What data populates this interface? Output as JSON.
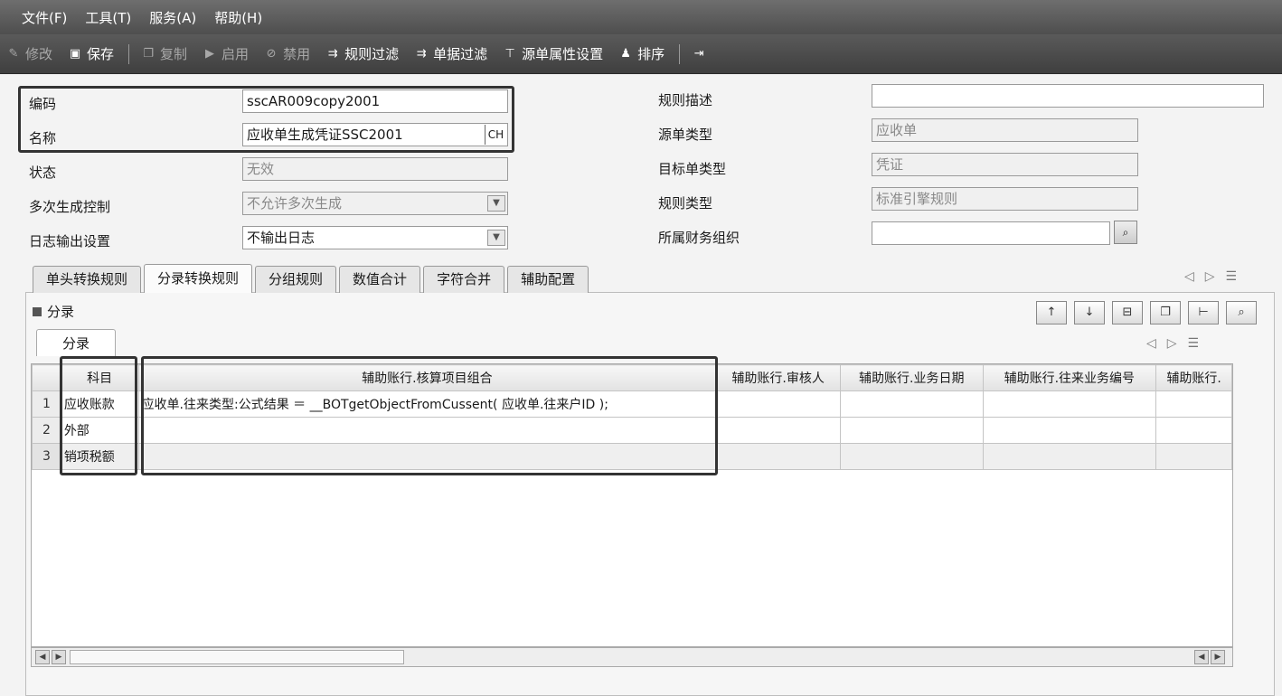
{
  "menu": [
    "文件(F)",
    "工具(T)",
    "服务(A)",
    "帮助(H)"
  ],
  "toolbar": [
    {
      "label": "修改",
      "icon": "edit-icon",
      "disabled": true
    },
    {
      "label": "保存",
      "icon": "save-icon",
      "disabled": false
    },
    {
      "label": "复制",
      "icon": "copy-icon",
      "disabled": true
    },
    {
      "label": "启用",
      "icon": "enable-icon",
      "disabled": true
    },
    {
      "label": "禁用",
      "icon": "disable-icon",
      "disabled": true
    },
    {
      "label": "规则过滤",
      "icon": "filter-icon",
      "disabled": false
    },
    {
      "label": "单据过滤",
      "icon": "filter-icon",
      "disabled": false
    },
    {
      "label": "源单属性设置",
      "icon": "funnel-icon",
      "disabled": false
    },
    {
      "label": "排序",
      "icon": "sort-icon",
      "disabled": false
    }
  ],
  "form": {
    "code_label": "编码",
    "code_value": "sscAR009copy2001",
    "name_label": "名称",
    "name_value": "应收单生成凭证SSC2001",
    "name_lang": "CH",
    "status_label": "状态",
    "status_value": "无效",
    "multi_label": "多次生成控制",
    "multi_value": "不允许多次生成",
    "log_label": "日志输出设置",
    "log_value": "不输出日志",
    "desc_label": "规则描述",
    "desc_value": "",
    "src_label": "源单类型",
    "src_value": "应收单",
    "tgt_label": "目标单类型",
    "tgt_value": "凭证",
    "rule_type_label": "规则类型",
    "rule_type_value": "标准引擎规则",
    "org_label": "所属财务组织",
    "org_value": ""
  },
  "tabs": [
    "单头转换规则",
    "分录转换规则",
    "分组规则",
    "数值合计",
    "字符合并",
    "辅助配置"
  ],
  "active_tab": 1,
  "section_title": "分录",
  "subtab": "分录",
  "grid": {
    "columns": [
      "",
      "科目",
      "辅助账行.核算项目组合",
      "辅助账行.审核人",
      "辅助账行.业务日期",
      "辅助账行.往来业务编号",
      "辅助账行."
    ],
    "rows": [
      [
        "1",
        "应收账款",
        "应收单.往来类型:公式结果 ＝ __BOTgetObjectFromCussent( 应收单.往来户ID );",
        "",
        "",
        "",
        ""
      ],
      [
        "2",
        "外部",
        "",
        "",
        "",
        "",
        ""
      ],
      [
        "3",
        "销项税额",
        "",
        "",
        "",
        "",
        ""
      ]
    ]
  }
}
